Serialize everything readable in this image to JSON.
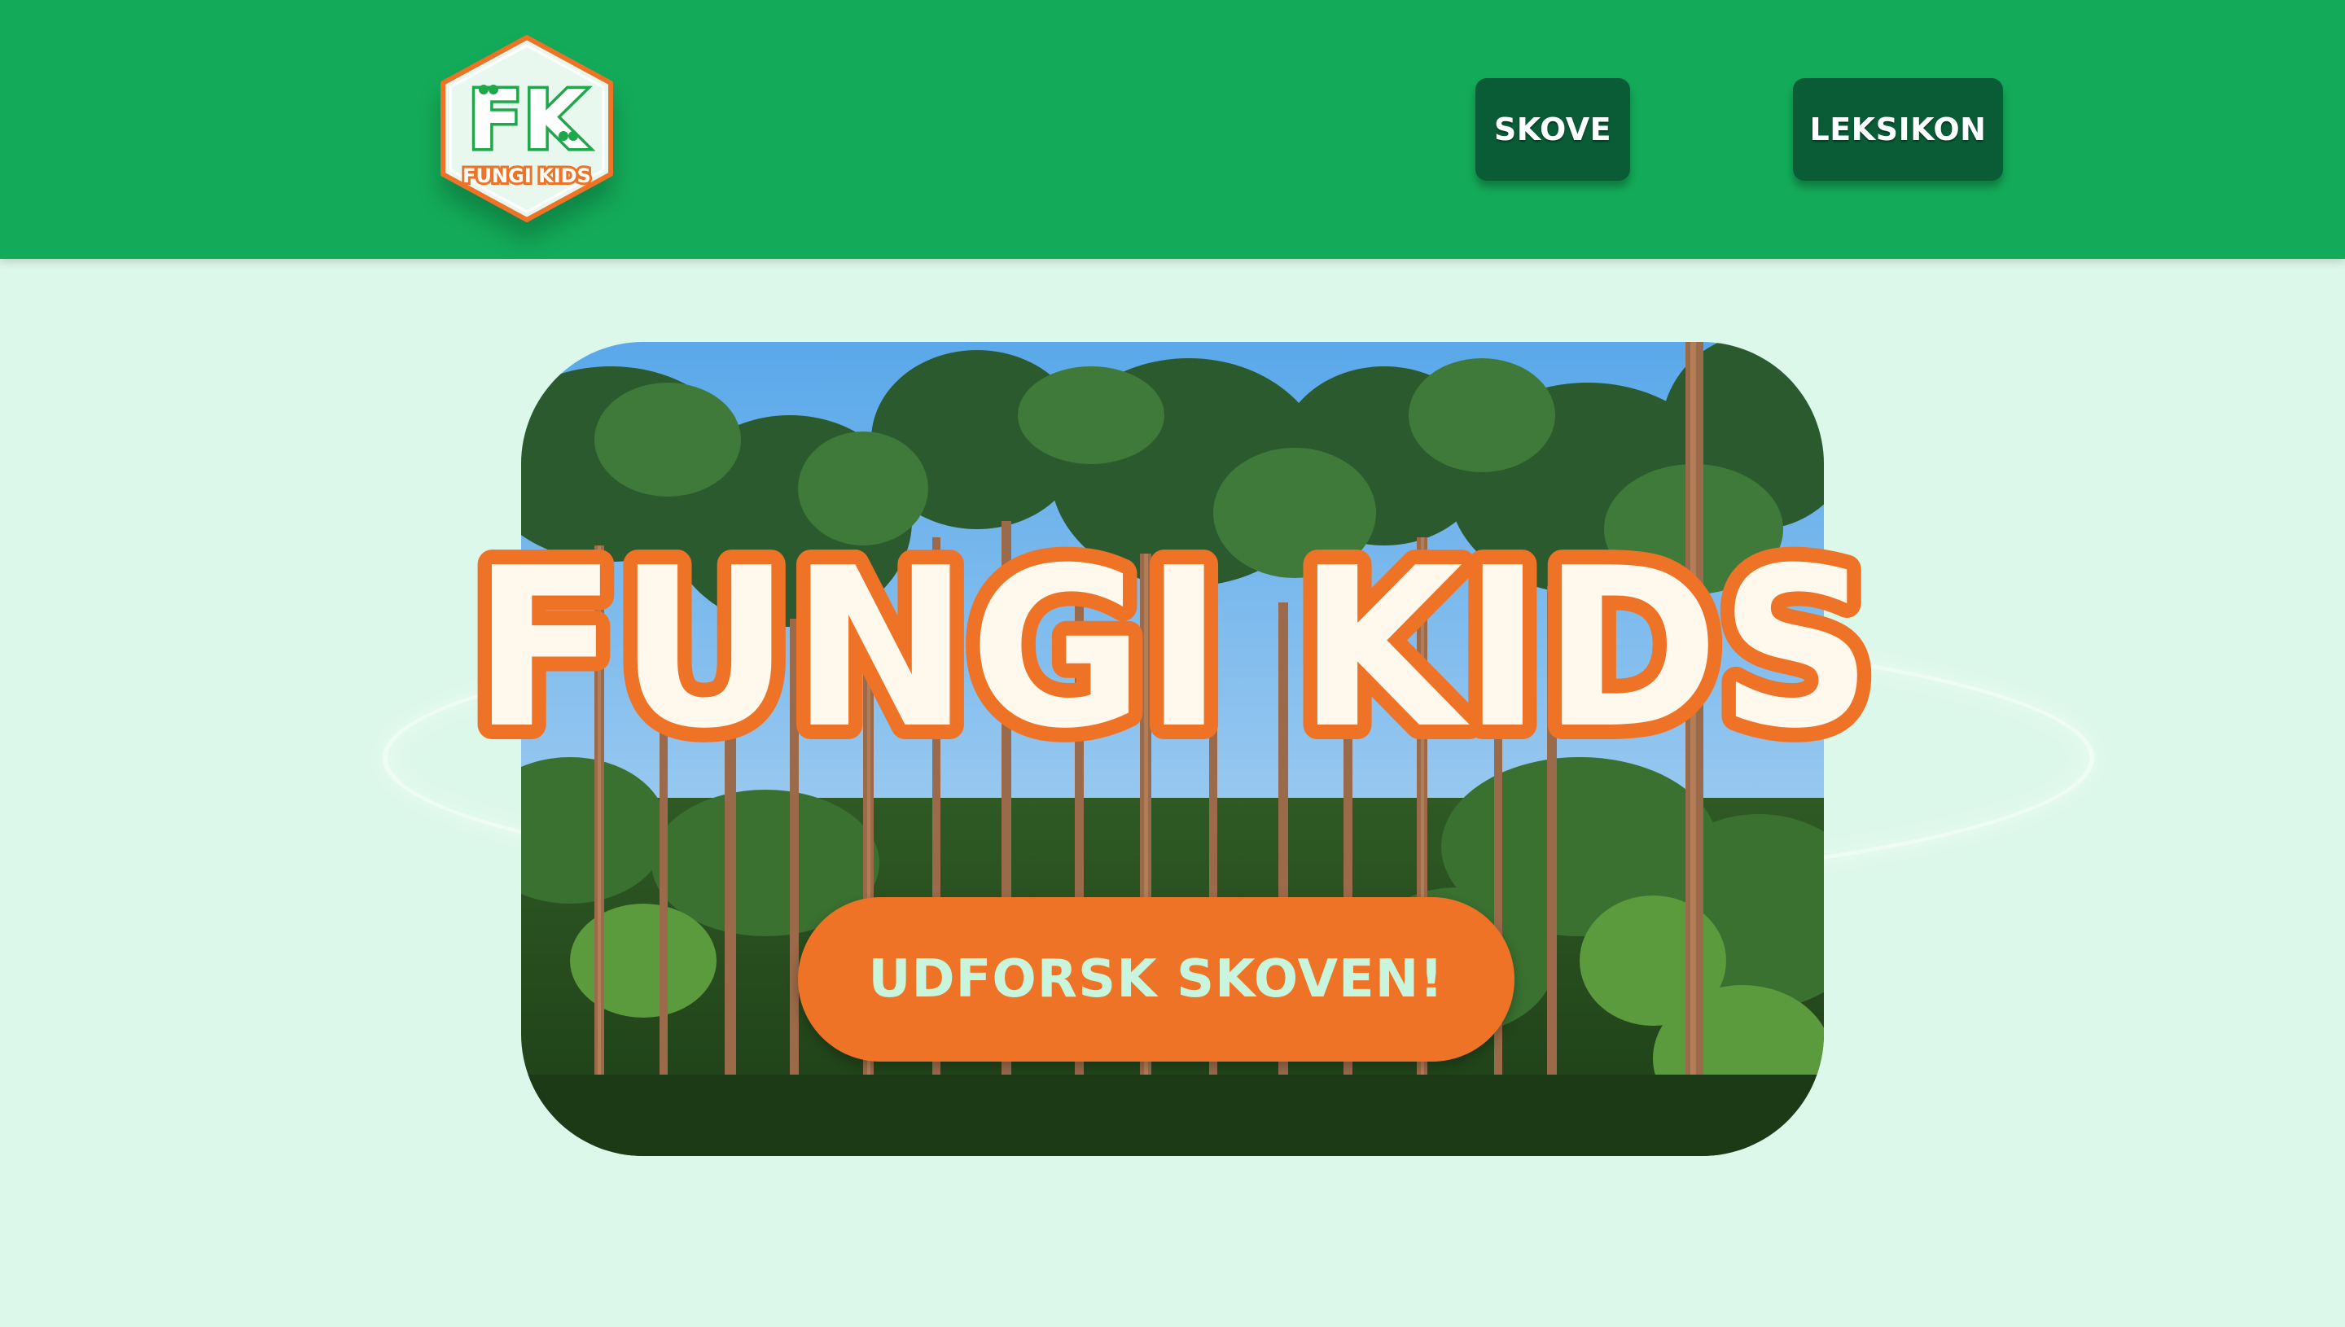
{
  "header": {
    "logo": {
      "initials": "FK",
      "brand": "FUNGI KIDS",
      "icon": "fungi-kids-logo-icon"
    },
    "nav": [
      {
        "label": "SKOVE"
      },
      {
        "label": "LEKSIKON"
      }
    ]
  },
  "hero": {
    "image": "pine-forest-image",
    "title": "FUNGI KIDS",
    "cta_label": "UDFORSK SKOVEN!"
  },
  "colors": {
    "header_bg": "#13ab59",
    "page_bg": "#dcf8ea",
    "nav_button_bg": "#0a5c37",
    "accent_orange": "#ee7326",
    "title_fill": "#fff8ec",
    "cta_text": "#c8f5dc"
  }
}
